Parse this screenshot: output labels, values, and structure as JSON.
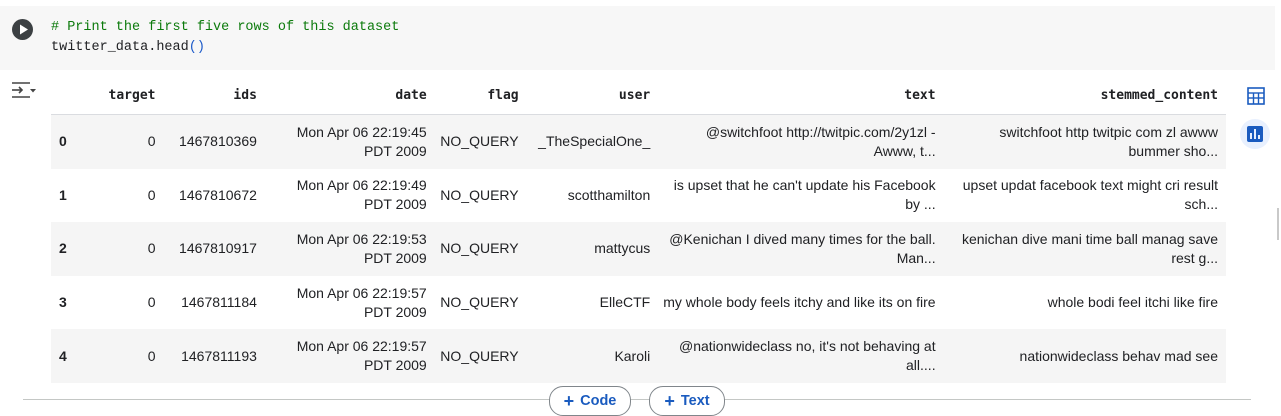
{
  "cell": {
    "code_comment": "# Print the first five rows of this dataset",
    "code_call": "twitter_data.head",
    "code_parens": "()"
  },
  "table": {
    "columns": [
      "",
      "target",
      "ids",
      "date",
      "flag",
      "user",
      "text",
      "stemmed_content"
    ],
    "rows": [
      [
        "0",
        "0",
        "1467810369",
        "Mon Apr 06 22:19:45 PDT 2009",
        "NO_QUERY",
        "_TheSpecialOne_",
        "@switchfoot http://twitpic.com/2y1zl - Awww, t...",
        "switchfoot http twitpic com zl awww bummer sho..."
      ],
      [
        "1",
        "0",
        "1467810672",
        "Mon Apr 06 22:19:49 PDT 2009",
        "NO_QUERY",
        "scotthamilton",
        "is upset that he can't update his Facebook by ...",
        "upset updat facebook text might cri result sch..."
      ],
      [
        "2",
        "0",
        "1467810917",
        "Mon Apr 06 22:19:53 PDT 2009",
        "NO_QUERY",
        "mattycus",
        "@Kenichan I dived many times for the ball. Man...",
        "kenichan dive mani time ball manag save rest g..."
      ],
      [
        "3",
        "0",
        "1467811184",
        "Mon Apr 06 22:19:57 PDT 2009",
        "NO_QUERY",
        "ElleCTF",
        "my whole body feels itchy and like its on fire",
        "whole bodi feel itchi like fire"
      ],
      [
        "4",
        "0",
        "1467811193",
        "Mon Apr 06 22:19:57 PDT 2009",
        "NO_QUERY",
        "Karoli",
        "@nationwideclass no, it's not behaving at all....",
        "nationwideclass behav mad see"
      ]
    ]
  },
  "toolbar": {
    "add_code_label": "Code",
    "add_text_label": "Text",
    "plus_glyph": "+"
  },
  "icons": {
    "run": "play-icon",
    "output_menu": "output-options-icon",
    "table_view": "table-icon",
    "chart_suggest": "bar-chart-icon"
  },
  "colors": {
    "accent": "#1a5bbf",
    "comment": "#0b7a0b",
    "chart_bg": "#e8f0fe"
  }
}
